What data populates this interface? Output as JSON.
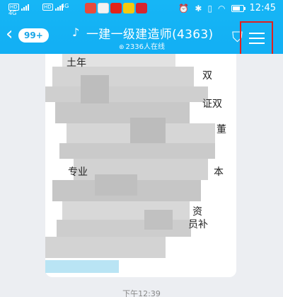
{
  "status_bar": {
    "time": "12:45",
    "signal1": "4G",
    "signal2": "4G",
    "hd1": "HD",
    "hd2": "HD"
  },
  "header": {
    "back_glyph": "‹",
    "unread_badge": "99+",
    "group_name": "一建一级建造师(4363)",
    "online_count": "2336人在线",
    "menu_icon": "menu-icon",
    "shield_icon": "shield-icon"
  },
  "message": {
    "visible_fragments": [
      "土年",
      "双",
      "证双",
      "董",
      "专业",
      "本",
      "资",
      "员补"
    ],
    "timestamp": "下午12:39"
  },
  "colors": {
    "header_blue": "#14b1f4",
    "highlight_red": "#e0201f",
    "chat_bg": "#eceef2"
  }
}
